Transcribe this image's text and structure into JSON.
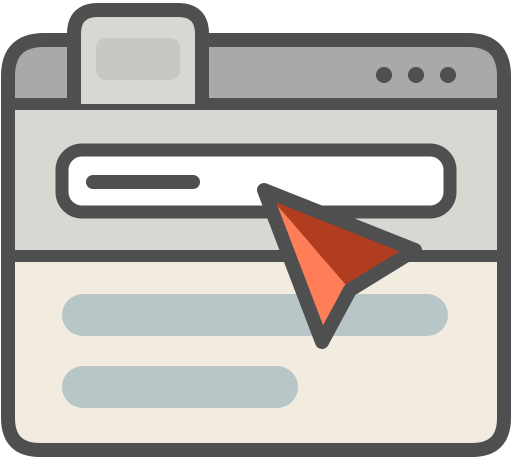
{
  "illustration": {
    "kind": "browser-window-with-cursor",
    "icon": "browser-window-icon",
    "window_controls": [
      "window-control-dot",
      "window-control-dot",
      "window-control-dot"
    ],
    "address_bar": {
      "has_text_line": true
    },
    "content_placeholder_lines": 2,
    "cursor": "pointer-cursor-icon"
  },
  "colors": {
    "outline": "#4F4F4F",
    "title_bar": "#A9A9A9",
    "tab": "#D9D7D1",
    "tab_inner": "#C9C7C1",
    "toolbar": "#D9D7D1",
    "address_field": "#FFFFFF",
    "content": "#F1ECDF",
    "placeholder_line": "#B8C6C8",
    "cursor_light": "#FF7E58",
    "cursor_dark": "#B13D20"
  }
}
